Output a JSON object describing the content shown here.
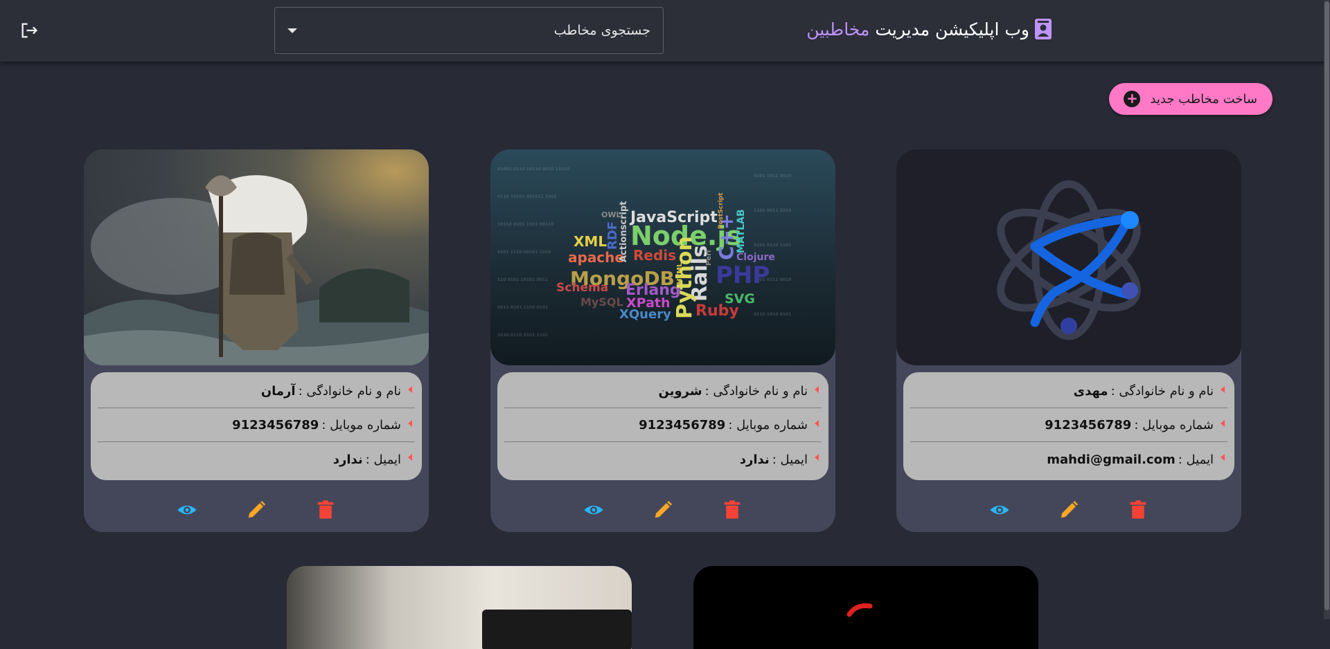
{
  "header": {
    "brand_text": "وب اپلیکیشن مدیریت",
    "brand_accent": "مخاطبین",
    "search_placeholder": "جستجوی مخاطب",
    "logout_icon": "logout-icon"
  },
  "toolbar": {
    "new_contact_label": "ساخت مخاطب جدید"
  },
  "labels": {
    "name": "نام و نام خانوادگی :",
    "mobile": "شماره موبایل :",
    "email": "ایمیل :"
  },
  "contacts": [
    {
      "name": "مهدی",
      "mobile": "9123456789",
      "email": "mahdi@gmail.com",
      "photo": "atom-logo"
    },
    {
      "name": "شروین",
      "mobile": "9123456789",
      "email": "ندارد",
      "photo": "programming-languages-word-cloud"
    },
    {
      "name": "آرمان",
      "mobile": "9123456789",
      "email": "ندارد",
      "photo": "armored-warrior-in-storm"
    }
  ],
  "wordcloud": [
    "JavaScript",
    "Node.js",
    "XML",
    "apache",
    "Redis",
    "MongoDB",
    "Rails",
    "PHP",
    "C++",
    "Erlang",
    "Python",
    "Schema",
    "XPath",
    "SVG",
    "Ruby",
    "XQuery",
    "RDF",
    "MATLAB",
    "Actionscript",
    "PostScript",
    "Clojure",
    "HTML",
    "OWL",
    "Perl",
    "MySQL"
  ],
  "colors": {
    "background": "#282a36",
    "card": "#44475a",
    "accent_purple": "#bd93f9",
    "button_pink": "#ff79c6",
    "view": "#29b6f6",
    "edit": "#f9a825",
    "delete": "#f44336"
  }
}
